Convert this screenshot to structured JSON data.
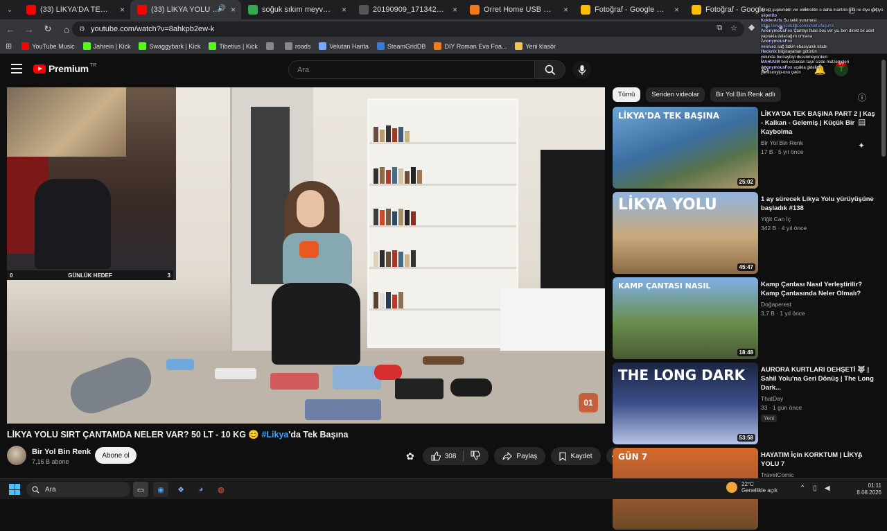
{
  "browser": {
    "tabs": [
      {
        "title": "(33) LİKYA'DA TEK BAŞINA PAR",
        "icon": "youtube-icon",
        "color": "#ff0000",
        "active": false
      },
      {
        "title": "(33) LİKYA YOLU SIRT ÇANT",
        "icon": "youtube-icon",
        "color": "#ff0000",
        "active": true
      },
      {
        "title": "soğuk sıkım meyve suyu makin",
        "icon": "google-drive-icon",
        "color": "#34a853",
        "active": false
      },
      {
        "title": "20190909_171342-2.jpg (2500",
        "icon": "image-icon",
        "color": "#555555",
        "active": false
      },
      {
        "title": "Orret Home USB Şarjlı Mini El F",
        "icon": "shop-icon",
        "color": "#f27a1a",
        "active": false
      },
      {
        "title": "Fotoğraf - Google Fotoğraflar",
        "icon": "google-photos-icon",
        "color": "#fbbc04",
        "active": false
      },
      {
        "title": "Fotoğraf - Google Fotoğraflar",
        "icon": "google-photos-icon",
        "color": "#fbbc04",
        "active": false
      }
    ],
    "url": "youtube.com/watch?v=8ahkpb2ew-k",
    "bookmarks": [
      {
        "label": "YouTube Music",
        "color": "#ff0000",
        "icon": "youtube-music-icon"
      },
      {
        "label": "Jahrein | Kick",
        "color": "#53fc18",
        "icon": "kick-icon"
      },
      {
        "label": "Swaggybark | Kick",
        "color": "#53fc18",
        "icon": "kick-icon"
      },
      {
        "label": "Tibetius | Kick",
        "color": "#53fc18",
        "icon": "kick-icon"
      },
      {
        "label": "",
        "color": "#888888",
        "icon": "globe-icon"
      },
      {
        "label": "roads",
        "color": "#888888",
        "icon": "globe-icon"
      },
      {
        "label": "Velutan Harita",
        "color": "#7aa7ff",
        "icon": "map-icon"
      },
      {
        "label": "SteamGridDB",
        "color": "#3a7bd5",
        "icon": "steam-icon"
      },
      {
        "label": "DIY Roman Eva Foa...",
        "color": "#f27a1a",
        "icon": "shop-icon"
      },
      {
        "label": "Yeni klasör",
        "color": "#f2c14e",
        "icon": "folder-icon"
      }
    ]
  },
  "youtube": {
    "logo_text": "Premium",
    "country": "TR",
    "search_placeholder": "Ara",
    "notification_count": "9+",
    "video": {
      "title_main": "LİKYA YOLU SIRT ÇANTAMDA NELER VAR? 50 LT - 10 KG 😊",
      "title_hashtag": "#Likya",
      "title_suffix": "'da Tek Başına",
      "channel": "Bir Yol Bin Renk",
      "subscribers": "7,16 B abone",
      "subscribe_label": "Abone ol",
      "likes": "308",
      "share_label": "Paylaş",
      "save_label": "Kaydet"
    },
    "overlay": {
      "goal_left": "0",
      "goal_label": "GÜNLÜK HEDEF",
      "goal_right": "3",
      "watermark": "01"
    },
    "chips": [
      "Tümü",
      "Seriden videolar",
      "Bir Yol Bin Renk adlı"
    ],
    "recommendations": [
      {
        "title": "LİKYA'DA TEK BAŞINA PART 2 | Kaş - Kalkan - Gelemiş | Küçük Bir Kaybolma",
        "channel": "Bir Yol Bin Renk",
        "stats": "17 B · 5 yıl önce",
        "duration": "25:02",
        "overlay": "LİKYA'DA TEK BAŞINA",
        "badge": ""
      },
      {
        "title": "1 ay sürecek Likya Yolu yürüyüşüne başladık #138",
        "channel": "Yiğit Can İç",
        "stats": "342 B · 4 yıl önce",
        "duration": "45:47",
        "overlay": "LİKYA YOLU",
        "badge": ""
      },
      {
        "title": "Kamp Çantası Nasıl Yerleştirilir? Kamp Çantasında Neler Olmalı?",
        "channel": "Doğaperest",
        "stats": "3,7 B · 1 yıl önce",
        "duration": "18:48",
        "overlay": "KAMP ÇANTASI NASIL",
        "badge": ""
      },
      {
        "title": "AURORA KURTLARI DEHŞETİ 🐺 | Sahil Yolu'na Geri Dönüş | The Long Dark...",
        "channel": "ThatDay",
        "stats": "33 · 1 gün önce",
        "duration": "53:58",
        "overlay": "THE LONG DARK",
        "badge": "Yeni"
      },
      {
        "title": "HAYATIM İçin KORKTUM | LİKYA YOLU 7",
        "channel": "TravelComic",
        "stats": "",
        "duration": "",
        "overlay": "GÜN 7",
        "badge": ""
      }
    ]
  },
  "chat_overlay": [
    {
      "user": "",
      "text": "direkt suplement ver elektrolitin o daha mantıklı gibi ne diye geçiyo"
    },
    {
      "user": "siipetito",
      "text": ""
    },
    {
      "user": "KoklerArts",
      "text": "Su sekil yurumesi:"
    },
    {
      "user": "",
      "text": "https://www.youtube.com/shorts/fuguYA"
    },
    {
      "user": "AnonymousFox",
      "text": "Çantayı falan boş ver ya, ben direkt bir adet yaprakla dalacağım ormana"
    },
    {
      "user": "AnonymousFox",
      "text": ""
    },
    {
      "user": "veinvex",
      "text": "sağ fatkin ebasiyanik kitabı"
    },
    {
      "user": "Hecknix",
      "text": "bilgisayarları götürün"
    },
    {
      "user": "",
      "text": "yolunda burnaybiyi dusunmeyordum"
    },
    {
      "user": "MAHUUM",
      "text": "ben erzakları taşır sizde malzemeleri"
    },
    {
      "user": "AnonymousFox",
      "text": "uçakla gidelim"
    },
    {
      "user": "",
      "text": "yanlısınıyip-onu çekin"
    }
  ],
  "taskbar": {
    "search_placeholder": "Ara",
    "temperature": "22°C",
    "weather_text": "Genellikle açık",
    "time": "01:11",
    "date": "8.08.2026"
  }
}
